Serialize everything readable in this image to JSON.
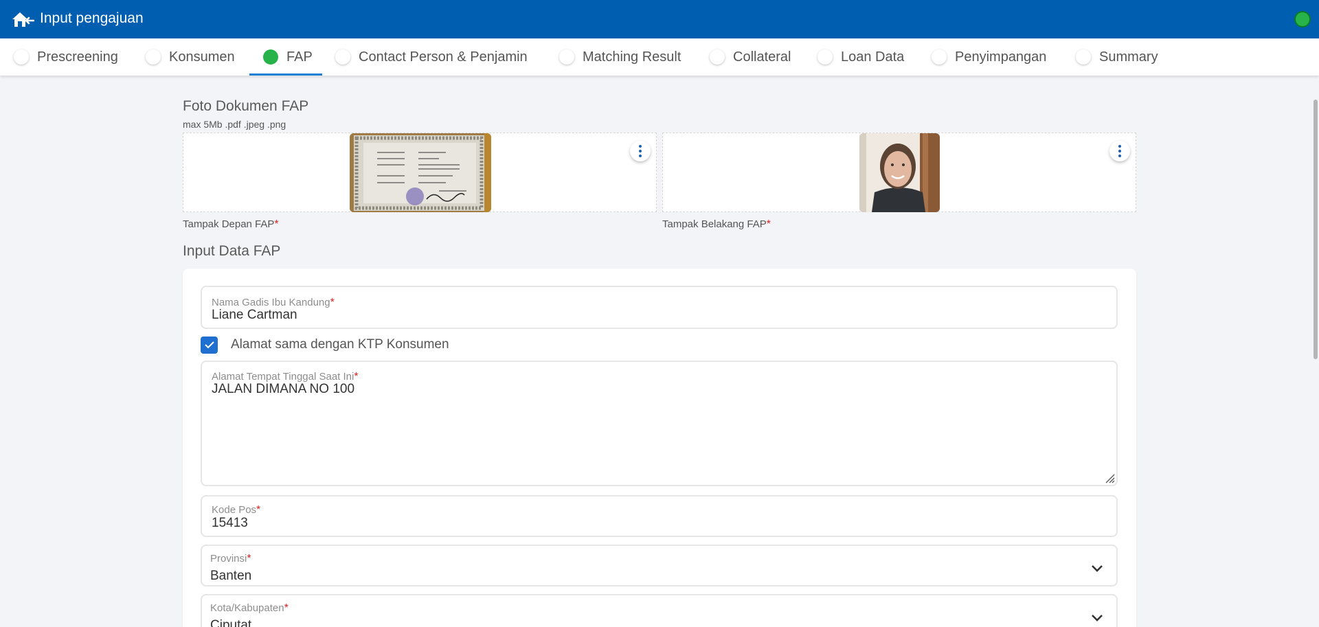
{
  "header": {
    "title": "Input pengajuan",
    "back_icon": "home-back-icon",
    "status_color": "#27b24a"
  },
  "tabs": [
    {
      "label": "Prescreening",
      "active": false
    },
    {
      "label": "Konsumen",
      "active": false
    },
    {
      "label": "FAP",
      "active": true
    },
    {
      "label": "Contact Person & Penjamin",
      "active": false
    },
    {
      "label": "Matching Result",
      "active": false
    },
    {
      "label": "Collateral",
      "active": false
    },
    {
      "label": "Loan Data",
      "active": false
    },
    {
      "label": "Penyimpangan",
      "active": false
    },
    {
      "label": "Summary",
      "active": false
    }
  ],
  "photos": {
    "title": "Foto Dokumen FAP",
    "note": "max 5Mb .pdf .jpeg .png",
    "front_caption": "Tampak Depan FAP",
    "back_caption": "Tampak Belakang FAP",
    "required_mark": "*"
  },
  "form": {
    "title": "Input Data FAP",
    "mother_name": {
      "label": "Nama Gadis Ibu Kandung",
      "value": "Liane Cartman"
    },
    "same_address": {
      "label": "Alamat sama dengan KTP Konsumen",
      "checked": true
    },
    "address": {
      "label": "Alamat Tempat Tinggal Saat Ini",
      "value": "JALAN DIMANA NO 100"
    },
    "postal_code": {
      "label": "Kode Pos",
      "value": "15413"
    },
    "province": {
      "label": "Provinsi",
      "value": "Banten"
    },
    "city": {
      "label": "Kota/Kabupaten",
      "value": "Ciputat"
    }
  },
  "colors": {
    "header": "#005eb0",
    "accent": "#1e7fd6",
    "checkbox": "#1e6fd0",
    "required": "#e02020"
  }
}
